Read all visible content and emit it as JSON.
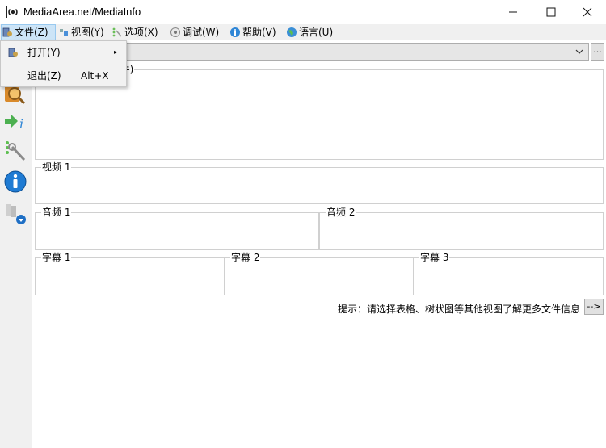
{
  "window": {
    "title": "MediaArea.net/MediaInfo",
    "minimize": "—",
    "maximize": "☐",
    "close": "✕"
  },
  "menubar": {
    "items": [
      {
        "label": "文件(Z)",
        "icon": "file-open-icon"
      },
      {
        "label": "视图(Y)",
        "icon": "view-icon"
      },
      {
        "label": "选项(X)",
        "icon": "options-icon"
      },
      {
        "label": "调试(W)",
        "icon": "debug-icon"
      },
      {
        "label": "帮助(V)",
        "icon": "help-icon"
      },
      {
        "label": "语言(U)",
        "icon": "language-icon"
      }
    ]
  },
  "file_menu": {
    "items": [
      {
        "label": "打开(Y)",
        "shortcut": "",
        "submenu": "▸"
      },
      {
        "label": "退出(Z)",
        "shortcut": "Alt+X"
      }
    ]
  },
  "toolbar": {
    "icons": [
      "open-media-icon",
      "export-info-icon",
      "preferences-icon",
      "about-icon",
      "file-info-icon"
    ]
  },
  "combo": {
    "more_button": "..."
  },
  "general_panel": {
    "label": "(件)"
  },
  "video_panel": {
    "label": "视频 1"
  },
  "audio_panels": [
    {
      "label": "音频 1"
    },
    {
      "label": "音频 2"
    }
  ],
  "text_panels": [
    {
      "label": "字幕 1"
    },
    {
      "label": "字幕 2"
    },
    {
      "label": "字幕 3"
    }
  ],
  "hint": {
    "text": "提示：请选择表格、树状图等其他视图了解更多文件信息",
    "button": "-->"
  },
  "colors": {
    "menu_active_bg": "#cce4f7",
    "menu_active_border": "#99c9ef",
    "chrome_bg": "#f0f0f0"
  }
}
